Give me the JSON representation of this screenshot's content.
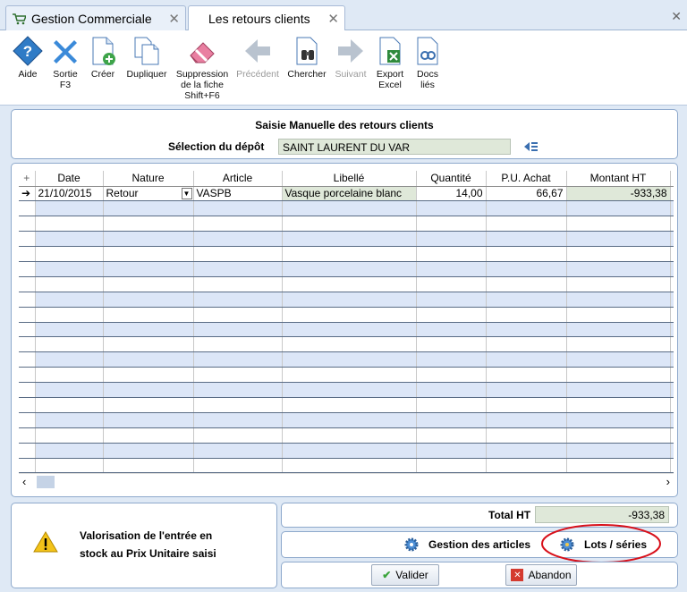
{
  "tabs": [
    {
      "label": "Gestion Commerciale",
      "active": false
    },
    {
      "label": "Les retours clients",
      "active": true
    }
  ],
  "toolbar": {
    "aide": "Aide",
    "sortie": [
      "Sortie",
      "F3"
    ],
    "creer": "Créer",
    "dupliquer": "Dupliquer",
    "suppression": [
      "Suppression",
      "de la fiche",
      "Shift+F6"
    ],
    "precedent": "Précédent",
    "chercher": "Chercher",
    "suivant": "Suivant",
    "export": [
      "Export",
      "Excel"
    ],
    "docs": [
      "Docs",
      "liés"
    ]
  },
  "header": {
    "title": "Saisie Manuelle des retours clients",
    "depot_label": "Sélection du dépôt",
    "depot_value": "SAINT LAURENT DU VAR"
  },
  "grid": {
    "columns": [
      "Date",
      "Nature",
      "Article",
      "Libellé",
      "Quantité",
      "P.U. Achat",
      "Montant HT"
    ],
    "rows": [
      {
        "date": "21/10/2015",
        "nature": "Retour",
        "article": "VASPB",
        "libelle": "Vasque porcelaine blanc",
        "quantite": "14,00",
        "pu_achat": "66,67",
        "montant_ht": "-933,38"
      }
    ]
  },
  "warning": {
    "line1": "Valorisation de l'entrée en",
    "line2": "stock au Prix Unitaire saisi"
  },
  "totals": {
    "label": "Total HT",
    "value": "-933,38"
  },
  "actions": {
    "gestion_articles": "Gestion des articles",
    "lots_series": "Lots / séries",
    "valider": "Valider",
    "abandon": "Abandon"
  },
  "colors": {
    "accent": "#2e7bc9",
    "row_alt": "#dce6f7",
    "field_green": "#dfe8d9",
    "highlight_ellipse": "#d8101a"
  }
}
